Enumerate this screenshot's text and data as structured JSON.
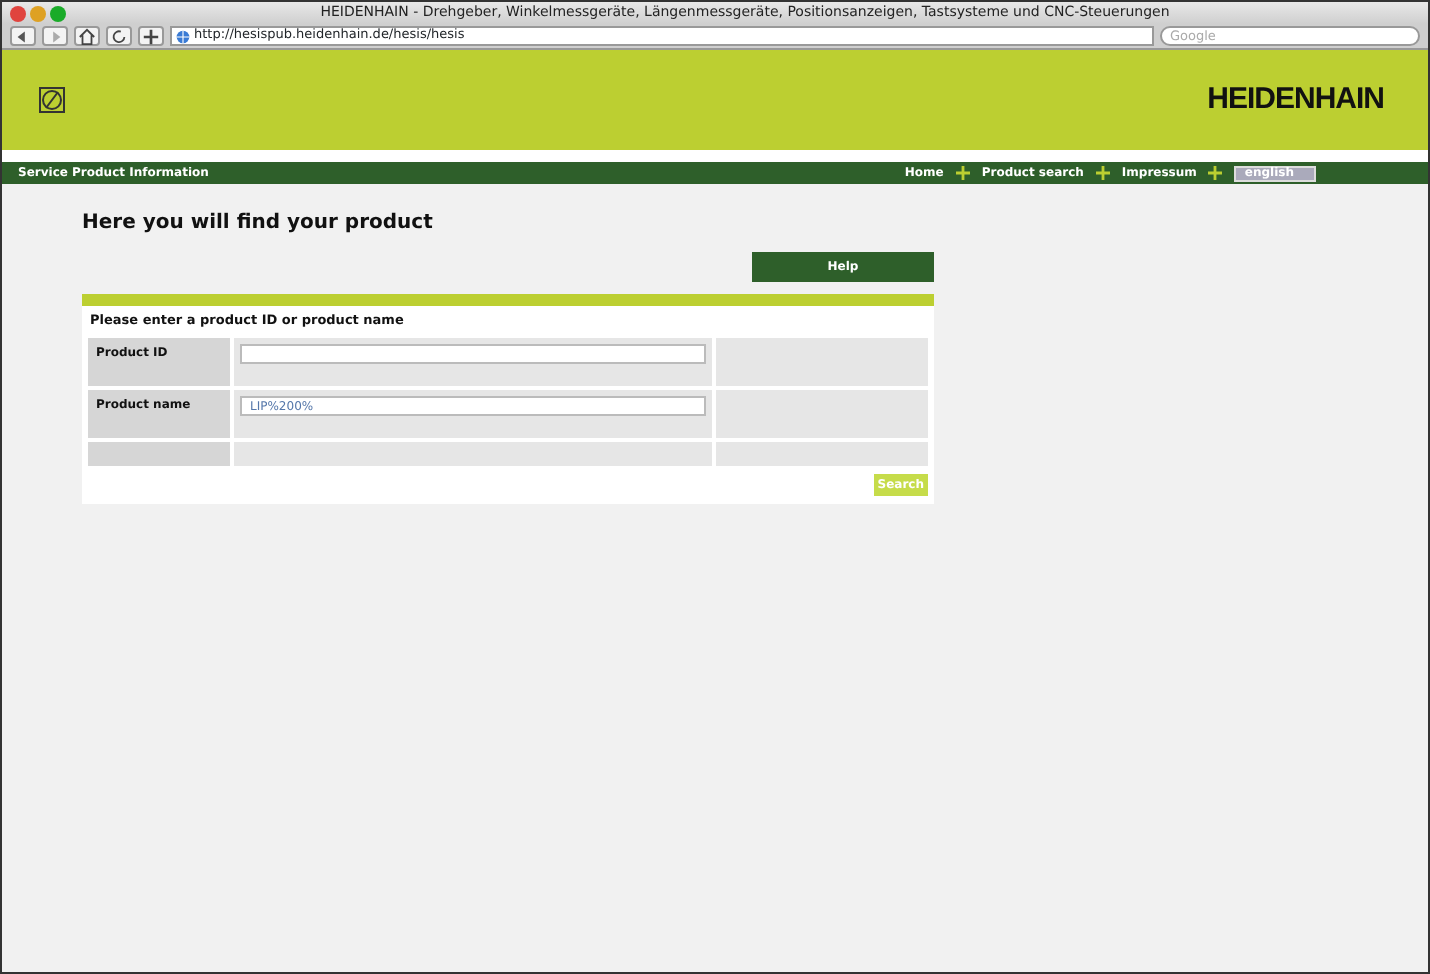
{
  "window": {
    "title": "HEIDENHAIN - Drehgeber, Winkelmessgeräte, Längenmessgeräte, Positionsanzeigen, Tastsysteme und CNC-Steuerungen"
  },
  "toolbar": {
    "address": "http://hesispub.heidenhain.de/hesis/hesis",
    "search_placeholder": "Google"
  },
  "header": {
    "brand": "HEIDENHAIN"
  },
  "nav": {
    "title": "Service Product Information",
    "links": [
      "Home",
      "Product search",
      "Impressum"
    ],
    "language": "english"
  },
  "content": {
    "heading": "Here you will find your product",
    "help_button": "Help",
    "form_title": "Please enter a product ID or product name",
    "fields": [
      {
        "label": "Product ID"
      },
      {
        "label": "Product name",
        "value": "LIP%200%"
      }
    ],
    "search_button": "Search"
  }
}
